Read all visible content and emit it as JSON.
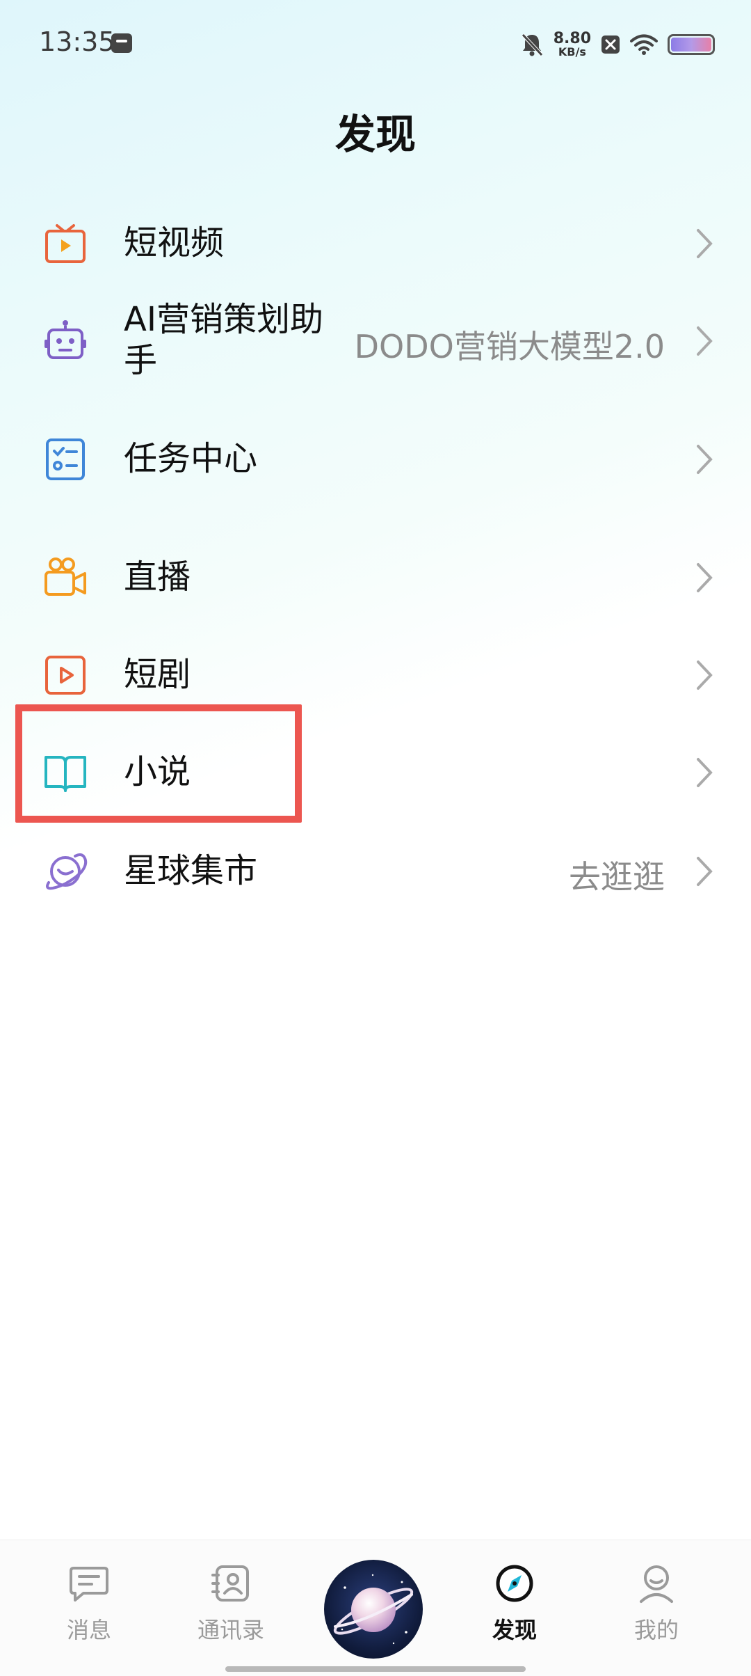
{
  "status_bar": {
    "time": "13:35",
    "net_speed_value": "8.80",
    "net_speed_unit": "KB/s",
    "icons": [
      "notification-app-icon",
      "mute-bell-icon",
      "close-box-icon",
      "wifi-icon",
      "battery-icon"
    ]
  },
  "header": {
    "title": "发现"
  },
  "menu": {
    "items": [
      {
        "label": "短视频",
        "value": "",
        "icon": "tv-play-icon",
        "color": "#e8643c"
      },
      {
        "label": "AI营销策划助手",
        "value": "DODO营销大模型2.0",
        "icon": "robot-icon",
        "color": "#7e5fc6"
      },
      {
        "label": "任务中心",
        "value": "",
        "icon": "checklist-icon",
        "color": "#3f86d8"
      },
      {
        "label": "直播",
        "value": "",
        "icon": "video-camera-icon",
        "color": "#f49b1f"
      },
      {
        "label": "短剧",
        "value": "",
        "icon": "play-box-icon",
        "color": "#e8643c"
      },
      {
        "label": "小说",
        "value": "",
        "icon": "open-book-icon",
        "color": "#25b5c0"
      },
      {
        "label": "星球集市",
        "value": "去逛逛",
        "icon": "planet-icon",
        "color": "#8a6fd0"
      }
    ]
  },
  "highlight_target": "小说",
  "highlight_color": "#ec5650",
  "tab_bar": {
    "tabs": [
      {
        "label": "消息",
        "icon": "chat-icon",
        "active": false
      },
      {
        "label": "通讯录",
        "icon": "contacts-icon",
        "active": false
      },
      {
        "label": "",
        "icon": "planet-center-icon",
        "active": false
      },
      {
        "label": "发现",
        "icon": "compass-icon",
        "active": true
      },
      {
        "label": "我的",
        "icon": "person-icon",
        "active": false
      }
    ]
  }
}
